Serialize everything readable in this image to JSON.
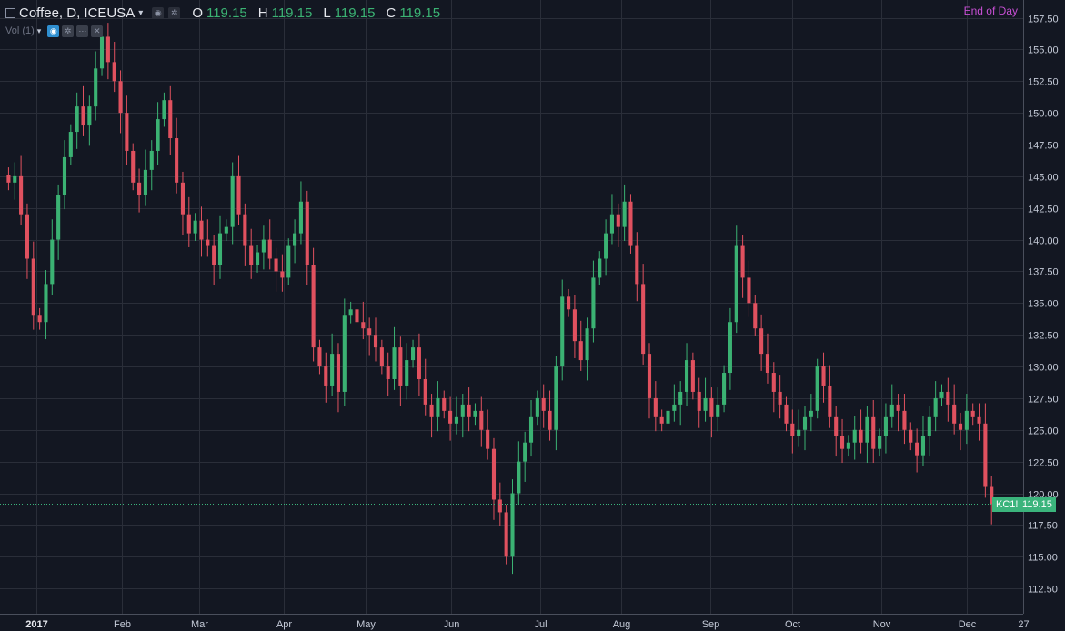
{
  "header": {
    "symbol": "Coffee, D, ICEUSA",
    "open_key": "O",
    "open": "119.15",
    "high_key": "H",
    "high": "119.15",
    "low_key": "L",
    "low": "119.15",
    "close_key": "C",
    "close": "119.15",
    "end_of_day": "End of Day"
  },
  "volume_indicator": {
    "label": "Vol (1)"
  },
  "price_tag": {
    "symbol": "KC1!",
    "price": "119.15"
  },
  "colors": {
    "up": "#3bb273",
    "down": "#e0515f",
    "background": "#131722",
    "grid": "#2a2e39",
    "last_price": "#3bb47c"
  },
  "chart_data": {
    "type": "candlestick",
    "title": "Coffee, D, ICEUSA",
    "x_axis": {
      "tick_labels": [
        "2017",
        "Feb",
        "Mar",
        "Apr",
        "May",
        "Jun",
        "Jul",
        "Aug",
        "Sep",
        "Oct",
        "Nov",
        "Dec",
        "27"
      ]
    },
    "y_axis": {
      "position": "right",
      "ylim": [
        110.5,
        158.9
      ],
      "ticks": [
        112.5,
        115.0,
        117.5,
        120.0,
        122.5,
        125.0,
        127.5,
        130.0,
        132.5,
        135.0,
        137.5,
        140.0,
        142.5,
        145.0,
        147.5,
        150.0,
        152.5,
        155.0,
        157.5
      ],
      "tick_labels": [
        "112.50",
        "115.00",
        "117.50",
        "120.00",
        "122.50",
        "125.00",
        "127.50",
        "130.00",
        "132.50",
        "135.00",
        "137.50",
        "140.00",
        "142.50",
        "145.00",
        "147.50",
        "150.00",
        "152.50",
        "155.00",
        "157.50"
      ]
    },
    "grid": true,
    "last_price": 119.15,
    "closes": [
      144.5,
      145.0,
      142.0,
      138.5,
      134.0,
      133.5,
      136.5,
      140.0,
      143.5,
      146.5,
      148.5,
      150.5,
      149.0,
      150.5,
      153.5,
      156.0,
      154.0,
      152.5,
      150.0,
      147.0,
      144.5,
      143.5,
      145.5,
      147.0,
      149.5,
      151.0,
      148.0,
      144.5,
      142.0,
      140.5,
      141.5,
      140.0,
      139.5,
      138.0,
      140.5,
      141.0,
      145.0,
      142.0,
      139.5,
      138.0,
      139.0,
      140.0,
      138.5,
      137.5,
      137.0,
      139.5,
      140.5,
      143.0,
      138.0,
      131.5,
      130.0,
      128.5,
      131.0,
      128.0,
      134.0,
      134.5,
      133.5,
      133.0,
      132.5,
      131.5,
      130.0,
      129.0,
      131.5,
      128.5,
      130.5,
      131.5,
      129.0,
      127.0,
      126.0,
      127.5,
      126.5,
      125.5,
      126.0,
      127.0,
      126.0,
      126.5,
      125.0,
      123.5,
      119.5,
      118.5,
      115.0,
      120.0,
      122.5,
      124.0,
      126.0,
      127.5,
      126.5,
      125.0,
      130.0,
      135.5,
      134.5,
      132.0,
      130.5,
      133.0,
      137.0,
      138.5,
      140.5,
      142.0,
      141.0,
      143.0,
      139.5,
      136.5,
      131.0,
      127.5,
      126.0,
      125.5,
      126.5,
      127.0,
      128.0,
      130.5,
      128.0,
      126.5,
      127.5,
      126.0,
      127.0,
      129.5,
      133.5,
      139.5,
      137.0,
      135.0,
      133.0,
      131.0,
      129.5,
      128.0,
      127.0,
      125.5,
      124.5,
      125.0,
      126.0,
      126.5,
      130.0,
      128.5,
      126.0,
      124.5,
      123.5,
      124.0,
      125.0,
      124.0,
      126.0,
      123.5,
      124.5,
      126.0,
      127.0,
      126.5,
      125.0,
      124.0,
      123.0,
      124.5,
      126.0,
      127.5,
      128.0,
      127.0,
      125.5,
      125.0,
      126.5,
      126.0,
      125.5,
      120.5,
      119.15
    ]
  }
}
